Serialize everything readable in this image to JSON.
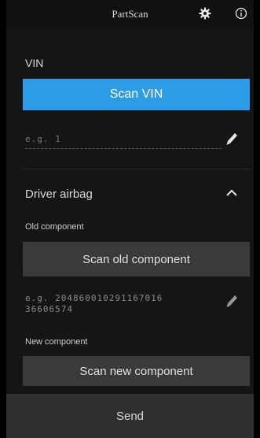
{
  "header": {
    "title": "PartScan",
    "settings_icon": "gear-icon",
    "info_icon": "info-icon"
  },
  "vin": {
    "label": "VIN",
    "scan_button": "Scan VIN",
    "placeholder": "e.g. 1",
    "edit_icon": "pencil-icon"
  },
  "section": {
    "title": "Driver airbag",
    "toggle_icon": "chevron-up-icon",
    "old_component": {
      "label": "Old component",
      "scan_button": "Scan old component",
      "placeholder": "e.g. 20486001029116701636606574",
      "placeholder_line1": "e.g. 204860010291167016",
      "placeholder_line2": "36606574"
    },
    "new_component": {
      "label": "New component",
      "scan_button": "Scan new component"
    }
  },
  "footer": {
    "send_button": "Send"
  },
  "colors": {
    "accent": "#2d9ce8",
    "background": "#151515",
    "secondary_button": "#3a3a3a",
    "send_bar": "#2f2f2f"
  }
}
